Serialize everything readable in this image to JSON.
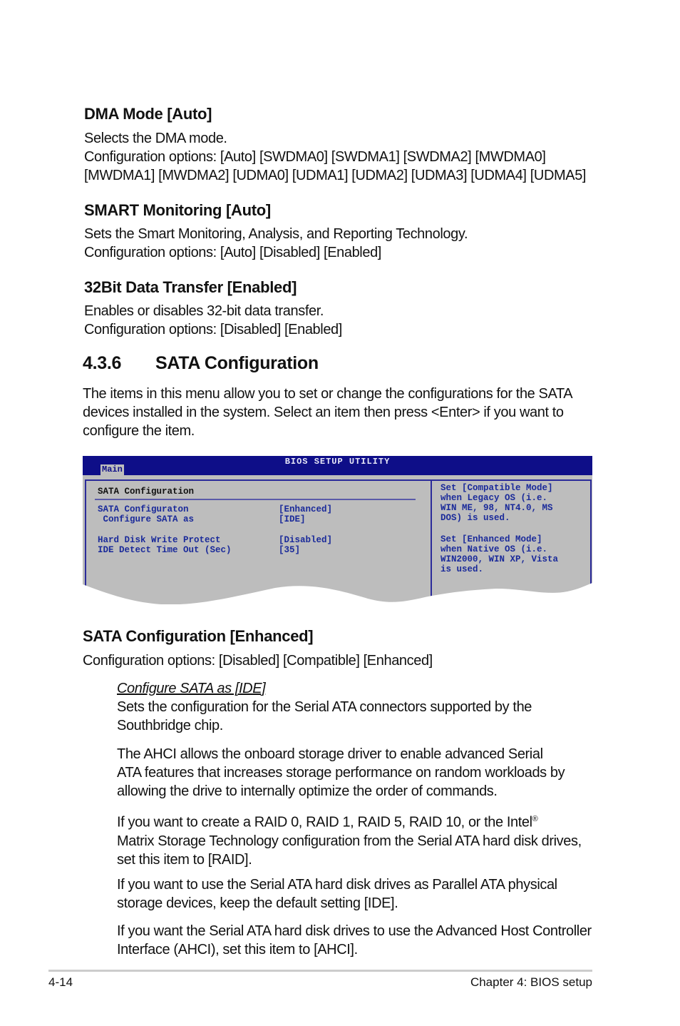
{
  "sections": [
    {
      "heading": "DMA Mode [Auto]",
      "lines": [
        "Selects the DMA mode.",
        "Configuration options: [Auto] [SWDMA0] [SWDMA1] [SWDMA2] [MWDMA0]",
        "[MWDMA1] [MWDMA2] [UDMA0] [UDMA1] [UDMA2] [UDMA3] [UDMA4] [UDMA5]"
      ]
    },
    {
      "heading": "SMART Monitoring [Auto]",
      "lines": [
        "Sets the Smart Monitoring, Analysis, and Reporting Technology.",
        "Configuration options: [Auto] [Disabled] [Enabled]"
      ]
    },
    {
      "heading": "32Bit Data Transfer [Enabled]",
      "lines": [
        "Enables or disables 32-bit data transfer.",
        "Configuration options: [Disabled] [Enabled]"
      ]
    }
  ],
  "section_436": {
    "number": "4.3.6",
    "title": "SATA Configuration",
    "intro": [
      "The items in this menu allow you to set or change the configurations for the SATA",
      "devices installed in the system. Select an item then press <Enter> if you want to",
      "configure the item."
    ]
  },
  "bios": {
    "title": "BIOS SETUP UTILITY",
    "tab": "Main",
    "panel_title": "SATA Configuration",
    "items": [
      {
        "label": "SATA Configuraton",
        "value": "[Enhanced]"
      },
      {
        "label": " Configure SATA as",
        "value": "[IDE]"
      },
      {
        "label": "Hard Disk Write Protect",
        "value": "[Disabled]"
      },
      {
        "label": "IDE Detect Time Out (Sec)",
        "value": "[35]"
      }
    ],
    "help": [
      "Set [Compatible Mode]",
      "when Legacy OS (i.e.",
      "WIN ME, 98, NT4.0, MS",
      "DOS) is used.",
      "",
      "Set [Enhanced Mode]",
      "when Native OS (i.e.",
      "WIN2000, WIN XP, Vista",
      "is used."
    ],
    "colors": {
      "header": "#0e0e88",
      "panel": "#bdbdbd",
      "text": "#1a2a9a"
    }
  },
  "sata_config": {
    "heading": "SATA Configuration [Enhanced]",
    "options": "Configuration options: [Disabled] [Compatible] [Enhanced]",
    "sub_heading": "Configure SATA as [IDE]",
    "p1": [
      "Sets the configuration for the Serial ATA connectors supported by the",
      "Southbridge chip."
    ],
    "p2": [
      "The AHCI allows the onboard storage driver to enable advanced Serial",
      "ATA features that increases storage performance on random workloads by",
      "allowing the drive to internally optimize the order of commands."
    ],
    "p3a": "If you want to create a RAID 0, RAID 1,  RAID 5,  RAID 10, or the Intel",
    "p3reg": "®",
    "p3": [
      "Matrix Storage Technology configuration from the Serial ATA hard disk drives,",
      "set this item to [RAID]."
    ],
    "p4": [
      "If you want to use the Serial ATA hard disk drives as Parallel ATA physical",
      "storage devices, keep the default setting [IDE]."
    ],
    "p5": [
      "If you want the Serial ATA hard disk drives to use the Advanced Host Controller",
      "Interface (AHCI), set this item to [AHCI]."
    ]
  },
  "footer": {
    "page": "4-14",
    "chapter": "Chapter 4: BIOS setup"
  }
}
